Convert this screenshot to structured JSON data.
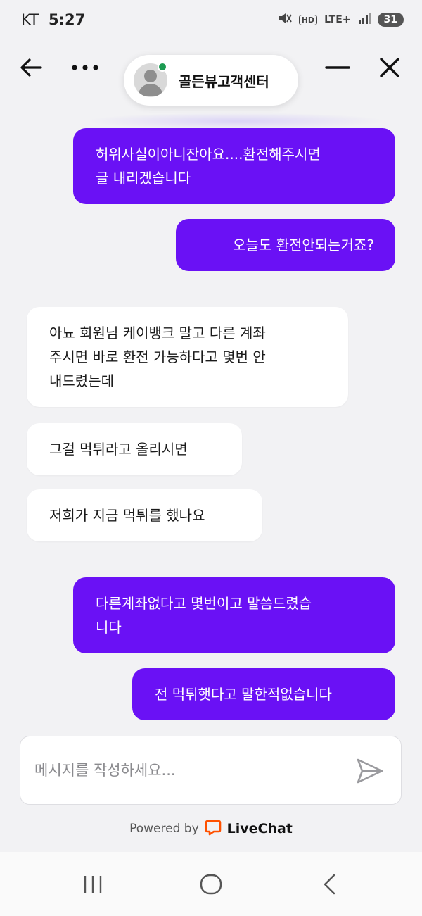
{
  "status_bar": {
    "carrier": "KT",
    "time": "5:27",
    "hd_label": "HD",
    "network": "LTE+",
    "battery": "31"
  },
  "header": {
    "agent_name": "골든뷰고객센터",
    "online_color": "#1c9b52"
  },
  "messages": [
    {
      "from": "user",
      "text": "허위사실이아니잔아요....환전해주시면\n글 내리겠습니다"
    },
    {
      "from": "user",
      "text": "오늘도 환전안되는거죠?"
    },
    {
      "from": "agent",
      "text": "아뇨 회원님 케이뱅크 말고 다른 계좌\n주시면 바로 환전 가능하다고 몇번 안\n내드렸는데"
    },
    {
      "from": "agent",
      "text": "그걸 먹튀라고 올리시면"
    },
    {
      "from": "agent",
      "text": "저희가 지금 먹튀를 했나요"
    },
    {
      "from": "user",
      "text": "다른계좌없다고 몇번이고 말씀드렸습\n니다"
    },
    {
      "from": "user",
      "text": "전 먹튀햇다고 말한적없습니다"
    }
  ],
  "composer": {
    "placeholder": "메시지를 작성하세요..."
  },
  "footer": {
    "powered_by": "Powered by",
    "brand": "LiveChat",
    "brand_color": "#ff5100"
  },
  "colors": {
    "user_bubble": "#6a11f5",
    "agent_bubble": "#ffffff",
    "background": "#f2f2f4"
  },
  "icons": {
    "back": "arrow-left-icon",
    "more": "more-horizontal-icon",
    "minimize": "minimize-icon",
    "close": "close-icon",
    "send": "send-icon"
  }
}
